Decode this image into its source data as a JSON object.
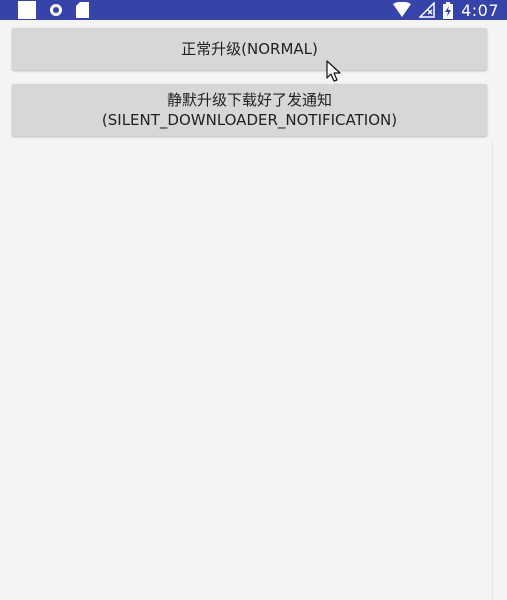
{
  "status_bar": {
    "time": "4:07",
    "background_color": "#3643a8",
    "left_icons": [
      "notification-square-icon",
      "sync-circle-icon",
      "sd-card-icon"
    ],
    "right_icons": [
      "wifi-icon",
      "no-signal-icon",
      "battery-charging-icon"
    ]
  },
  "buttons": {
    "normal_label": "正常升级(NORMAL)",
    "silent_line1": "静默升级下载好了发通知",
    "silent_line2": "(SILENT_DOWNLOADER_NOTIFICATION)"
  },
  "colors": {
    "background": "#f4f4f5",
    "button": "#d6d7d7",
    "button_text": "#222222"
  }
}
